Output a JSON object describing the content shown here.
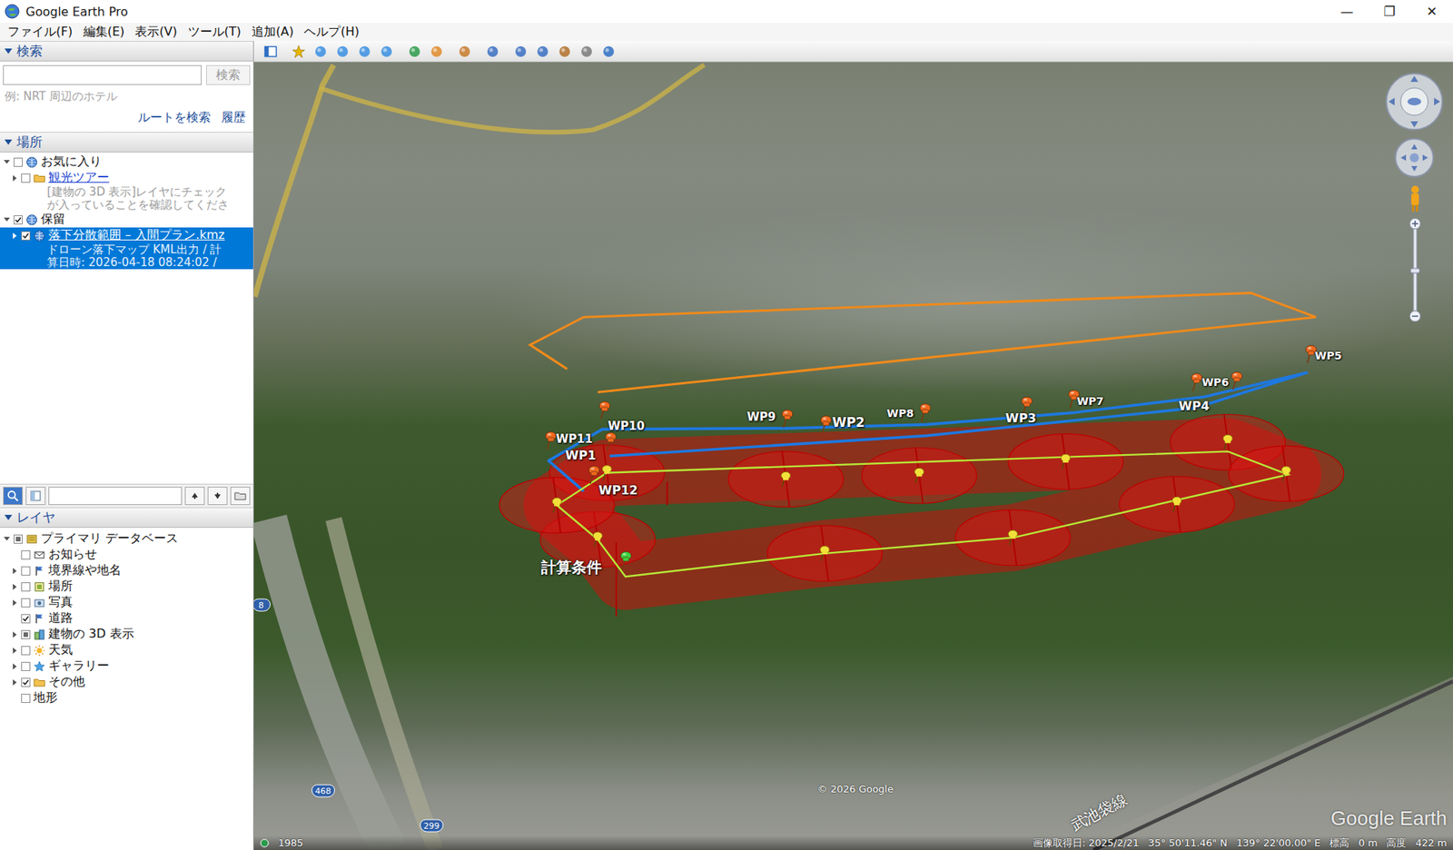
{
  "window": {
    "title": "Google Earth Pro",
    "controls": [
      "—",
      "❐",
      "✕"
    ]
  },
  "menu": [
    "ファイル(F)",
    "編集(E)",
    "表示(V)",
    "ツール(T)",
    "追加(A)",
    "ヘルプ(H)"
  ],
  "search": {
    "title": "検索",
    "expanded": true,
    "value": "",
    "button": "検索",
    "hint": "例: NRT 周辺のホテル",
    "links": [
      "ルートを検索",
      "履歴"
    ]
  },
  "places": {
    "title": "場所",
    "expanded": true,
    "items": [
      {
        "label": "お気に入り",
        "level": 0,
        "expander": "open",
        "checked": false,
        "partial": false,
        "kind": "globe",
        "link": false,
        "selected": false,
        "description": []
      },
      {
        "label": "観光ツアー",
        "level": 1,
        "expander": "closed",
        "checked": false,
        "partial": false,
        "kind": "folder",
        "link": true,
        "selected": false,
        "description": [
          "[建物の 3D 表示]レイヤにチェック",
          "が入っていることを確認してくださ"
        ]
      },
      {
        "label": "保留",
        "level": 0,
        "expander": "open",
        "checked": true,
        "partial": false,
        "kind": "globe",
        "link": false,
        "selected": false,
        "description": []
      },
      {
        "label": "落下分散範囲 – 入間プラン.kmz",
        "level": 1,
        "expander": "closed",
        "checked": true,
        "partial": false,
        "kind": "globe",
        "link": true,
        "selected": true,
        "description": [
          "ドローン落下マップ KML出力 / 計",
          "算日時: 2026-04-18 08:24:02 /"
        ]
      }
    ]
  },
  "layers": {
    "title": "レイヤ",
    "expanded": true,
    "items": [
      {
        "label": "プライマリ データベース",
        "level": 0,
        "expander": "open",
        "checked": false,
        "partial": true,
        "kind": "database"
      },
      {
        "label": "お知らせ",
        "level": 1,
        "expander": "none",
        "checked": false,
        "partial": false,
        "kind": "mail"
      },
      {
        "label": "境界線や地名",
        "level": 1,
        "expander": "closed",
        "checked": false,
        "partial": false,
        "kind": "flag"
      },
      {
        "label": "場所",
        "level": 1,
        "expander": "closed",
        "checked": false,
        "partial": false,
        "kind": "place"
      },
      {
        "label": "写真",
        "level": 1,
        "expander": "closed",
        "checked": false,
        "partial": false,
        "kind": "photo"
      },
      {
        "label": "道路",
        "level": 1,
        "expander": "none",
        "checked": true,
        "partial": false,
        "kind": "flag"
      },
      {
        "label": "建物の 3D 表示",
        "level": 1,
        "expander": "closed",
        "checked": false,
        "partial": true,
        "kind": "building"
      },
      {
        "label": "天気",
        "level": 1,
        "expander": "closed",
        "checked": false,
        "partial": false,
        "kind": "weather"
      },
      {
        "label": "ギャラリー",
        "level": 1,
        "expander": "closed",
        "checked": false,
        "partial": false,
        "kind": "star"
      },
      {
        "label": "その他",
        "level": 1,
        "expander": "closed",
        "checked": true,
        "partial": false,
        "kind": "folder"
      },
      {
        "label": "地形",
        "level": 1,
        "expander": "none",
        "checked": false,
        "partial": false,
        "kind": "plain"
      }
    ]
  },
  "map": {
    "waypoints": [
      {
        "label": "WP1"
      },
      {
        "label": "WP2"
      },
      {
        "label": "WP3"
      },
      {
        "label": "WP4"
      },
      {
        "label": "WP5"
      },
      {
        "label": "WP6"
      },
      {
        "label": "WP7"
      },
      {
        "label": "WP8"
      },
      {
        "label": "WP9"
      },
      {
        "label": "WP10"
      },
      {
        "label": "WP11"
      },
      {
        "label": "WP12"
      }
    ],
    "condition": {
      "label": "計算条件"
    },
    "roadShields": [
      "8",
      "468",
      "299"
    ],
    "railLabel": "武池袋線",
    "copyright": "© 2026 Google",
    "watermark": "Google Earth",
    "historyYear": "1985"
  },
  "status": {
    "imageDate": "画像取得日: 2025/2/21",
    "lat": "35° 50'11.46\" N",
    "lon": "139° 22'00.00\" E",
    "elevLabel": "標高",
    "elev": "0 m",
    "altLabel": "高度",
    "alt": "422 m"
  }
}
